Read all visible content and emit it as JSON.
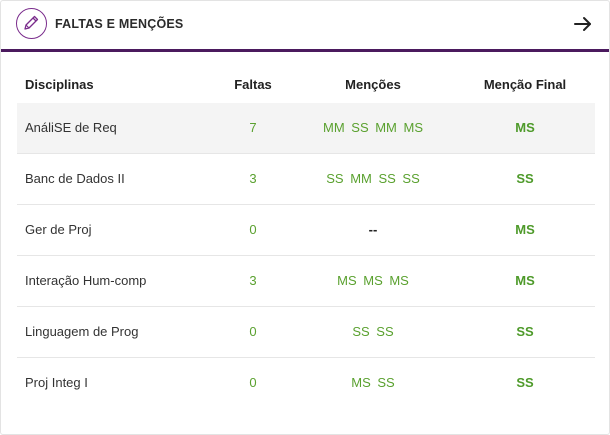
{
  "header": {
    "title": "FALTAS E MENÇÕES",
    "icon": "pencil-icon",
    "action_icon": "arrow-right-icon",
    "accent_color": "#4b1a5e"
  },
  "table": {
    "headers": {
      "disciplina": "Disciplinas",
      "faltas": "Faltas",
      "mencoes": "Menções",
      "mencao_final": "Menção Final"
    },
    "rows": [
      {
        "disciplina": "AnáliSE de Req",
        "faltas": "7",
        "mencoes": "MM  SS  MM  MS",
        "mencao_final": "MS"
      },
      {
        "disciplina": "Banc de Dados II",
        "faltas": "3",
        "mencoes": "SS  MM  SS  SS",
        "mencao_final": "SS"
      },
      {
        "disciplina": "Ger de Proj",
        "faltas": "0",
        "mencoes": "--",
        "mencao_final": "MS"
      },
      {
        "disciplina": "Interação Hum-comp",
        "faltas": "3",
        "mencoes": "MS  MS  MS",
        "mencao_final": "MS"
      },
      {
        "disciplina": "Linguagem de Prog",
        "faltas": "0",
        "mencoes": "SS  SS",
        "mencao_final": "SS"
      },
      {
        "disciplina": "Proj Integ I",
        "faltas": "0",
        "mencoes": "MS  SS",
        "mencao_final": "SS"
      }
    ],
    "value_color": "#5aa12f"
  }
}
